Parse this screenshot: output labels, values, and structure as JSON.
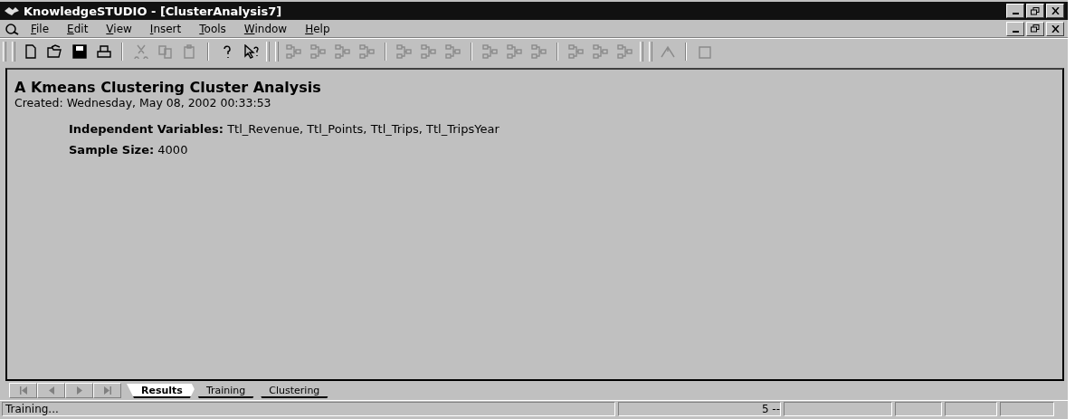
{
  "window": {
    "title": "KnowledgeSTUDIO - [ClusterAnalysis7]"
  },
  "menu": [
    {
      "label": "File"
    },
    {
      "label": "Edit"
    },
    {
      "label": "View"
    },
    {
      "label": "Insert"
    },
    {
      "label": "Tools"
    },
    {
      "label": "Window"
    },
    {
      "label": "Help"
    }
  ],
  "report": {
    "title": "A Kmeans Clustering Cluster Analysis",
    "created": "Created: Wednesday, May 08, 2002 00:33:53",
    "fields": [
      {
        "label": "Independent Variables:",
        "value": "Ttl_Revenue, Ttl_Points, Ttl_Trips, Ttl_TripsYear"
      },
      {
        "label": "Sample Size:",
        "value": "4000"
      }
    ]
  },
  "tabs": [
    {
      "label": "Results",
      "selected": true
    },
    {
      "label": "Training",
      "selected": false
    },
    {
      "label": "Clustering",
      "selected": false
    }
  ],
  "status_bar": {
    "message": "Training...",
    "indicator": "5 --"
  }
}
